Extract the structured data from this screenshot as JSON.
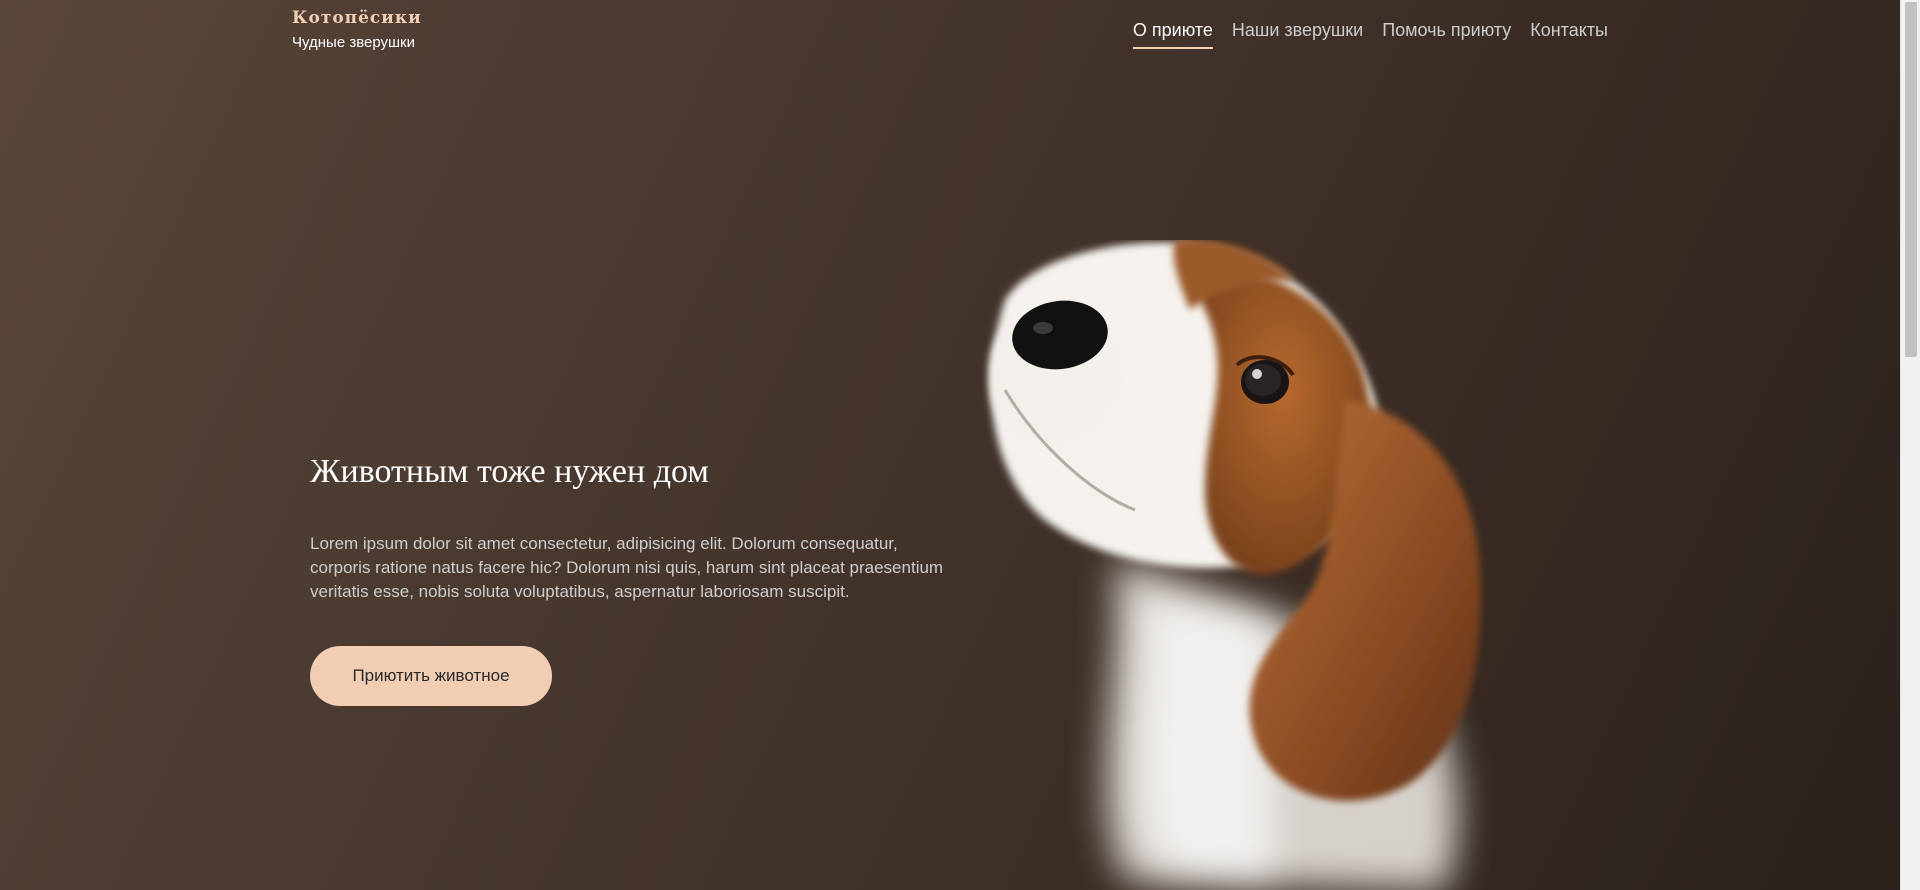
{
  "logo": {
    "title": "Котопёсики",
    "subtitle": "Чудные зверушки"
  },
  "nav": {
    "items": [
      {
        "label": "О приюте",
        "active": true
      },
      {
        "label": "Наши зверушки",
        "active": false
      },
      {
        "label": "Помочь приюту",
        "active": false
      },
      {
        "label": "Контакты",
        "active": false
      }
    ]
  },
  "hero": {
    "title": "Животным тоже нужен дом",
    "text": "Lorem ipsum dolor sit amet consectetur, adipisicing elit. Dolorum consequatur, corporis ratione natus facere hic? Dolorum nisi quis, harum sint placeat praesentium veritatis esse, nobis soluta voluptatibus, aspernatur laboriosam suscipit.",
    "button_label": "Приютить животное"
  },
  "colors": {
    "accent": "#f1cdb3",
    "background_dark": "#2a211c",
    "background_light": "#594539",
    "text_light": "#cdcdcd"
  },
  "icons": [
    "beagle-puppy-image"
  ]
}
